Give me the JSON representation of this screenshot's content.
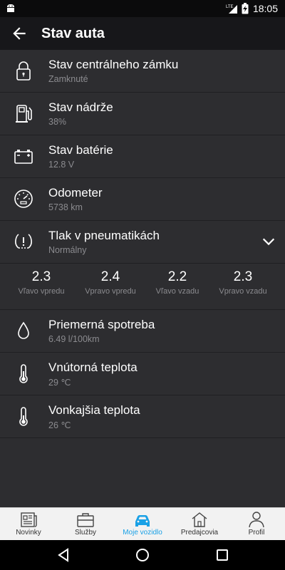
{
  "status_bar": {
    "time": "18:05",
    "network": "LTE",
    "icons": [
      "android-icon",
      "lte-icon",
      "signal-icon",
      "battery-charging-icon"
    ]
  },
  "app_bar": {
    "title": "Stav auta",
    "back_icon": "arrow-left-icon"
  },
  "rows": [
    {
      "label": "Stav centrálneho zámku",
      "value": "Zamknuté",
      "icon": "lock-icon"
    },
    {
      "label": "Stav nádrže",
      "value": "38%",
      "icon": "fuel-pump-icon"
    },
    {
      "label": "Stav batérie",
      "value": "12.8 V",
      "icon": "car-battery-icon"
    },
    {
      "label": "Odometer",
      "value": "5738 km",
      "icon": "speedometer-icon"
    },
    {
      "label": "Tlak v pneumatikách",
      "value": "Normálny",
      "icon": "tire-pressure-icon"
    },
    {
      "label": "Priemerná spotreba",
      "value": "6.49 l/100km",
      "icon": "drop-icon"
    },
    {
      "label": "Vnútorná teplota",
      "value": "29 ℃",
      "icon": "thermometer-icon"
    },
    {
      "label": "Vonkajšia teplota",
      "value": "26 ℃",
      "icon": "thermometer-icon"
    }
  ],
  "tires": [
    {
      "value": "2.3",
      "position": "Vľavo vpredu"
    },
    {
      "value": "2.4",
      "position": "Vpravo vpredu"
    },
    {
      "value": "2.2",
      "position": "Vľavo vzadu"
    },
    {
      "value": "2.3",
      "position": "Vpravo vzadu"
    }
  ],
  "bottom_nav": [
    {
      "label": "Novinky",
      "icon": "newspaper-icon"
    },
    {
      "label": "Služby",
      "icon": "briefcase-icon"
    },
    {
      "label": "Moje vozidlo",
      "icon": "car-icon",
      "active": true
    },
    {
      "label": "Predajcovia",
      "icon": "house-icon"
    },
    {
      "label": "Profil",
      "icon": "person-icon"
    }
  ],
  "colors": {
    "background": "#2d2d30",
    "app_bar": "#17171a",
    "accent": "#1aa1e6",
    "secondary_text": "#8b8b8f"
  }
}
